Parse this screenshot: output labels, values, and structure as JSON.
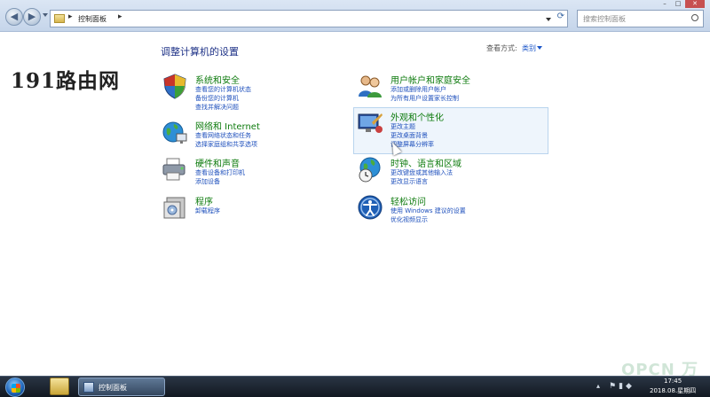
{
  "address_bar": {
    "crumb": "控制面板",
    "sep": "▸",
    "search_placeholder": "搜索控制面板"
  },
  "window_controls": {
    "minimize": "–",
    "maximize": "□",
    "close": "✕"
  },
  "header": {
    "title": "调整计算机的设置",
    "view_by_label": "查看方式:",
    "view_by_value": "类别"
  },
  "watermark": "191路由网",
  "categories_left": [
    {
      "title": "系统和安全",
      "icon": "shield-icon",
      "links": [
        "查看您的计算机状态",
        "备份您的计算机",
        "查找并解决问题"
      ]
    },
    {
      "title": "网络和 Internet",
      "icon": "network-icon",
      "links": [
        "查看网络状态和任务",
        "选择家庭组和共享选项"
      ]
    },
    {
      "title": "硬件和声音",
      "icon": "printer-icon",
      "links": [
        "查看设备和打印机",
        "添加设备"
      ]
    },
    {
      "title": "程序",
      "icon": "programs-icon",
      "links": [
        "卸载程序"
      ]
    }
  ],
  "categories_right": [
    {
      "title": "用户帐户和家庭安全",
      "icon": "users-icon",
      "links": [
        "添加或删除用户帐户",
        "为所有用户设置家长控制"
      ]
    },
    {
      "title": "外观和个性化",
      "icon": "appearance-icon",
      "links": [
        "更改主题",
        "更改桌面背景",
        "调整屏幕分辨率"
      ]
    },
    {
      "title": "时钟、语言和区域",
      "icon": "globe-clock-icon",
      "links": [
        "更改键盘或其他输入法",
        "更改显示语言"
      ]
    },
    {
      "title": "轻松访问",
      "icon": "ease-of-access-icon",
      "links": [
        "使用 Windows 建议的设置",
        "优化视频显示"
      ]
    }
  ],
  "taskbar": {
    "active_window": "控制面板",
    "time": "17:45",
    "date": "2018.08.星期四"
  },
  "corner_watermark": "OPCN 万能家园"
}
